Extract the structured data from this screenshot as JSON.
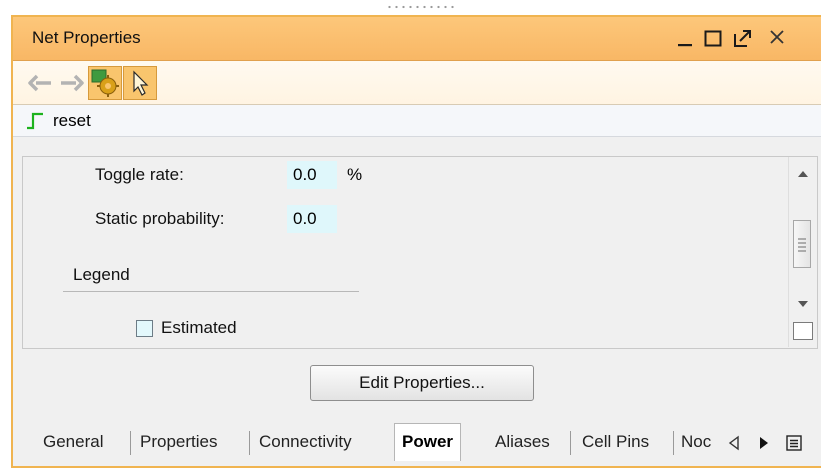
{
  "panel": {
    "title": "Net Properties",
    "window_controls": [
      "minimize",
      "maximize",
      "float",
      "close"
    ]
  },
  "toolbar": {
    "icons": [
      "arrow-left-icon",
      "arrow-right-icon",
      "auto-update-icon",
      "select-pointer-icon"
    ]
  },
  "net": {
    "name": "reset",
    "icon": "net-step-icon",
    "icon_color": "#1db21d"
  },
  "power": {
    "toggle_rate_label": "Toggle rate:",
    "toggle_rate_value": "0.0",
    "toggle_rate_unit": "%",
    "static_probability_label": "Static probability:",
    "static_probability_value": "0.0",
    "legend_title": "Legend",
    "legend_estimated": "Estimated",
    "estimated_color": "#dff7fb"
  },
  "actions": {
    "edit_properties": "Edit Properties..."
  },
  "tabs": {
    "items": [
      "General",
      "Properties",
      "Connectivity",
      "Power",
      "Aliases",
      "Cell Pins",
      "Noc"
    ],
    "active": "Power"
  },
  "colors": {
    "titlebar": "#f8b765",
    "panel_border": "#f0b450"
  }
}
